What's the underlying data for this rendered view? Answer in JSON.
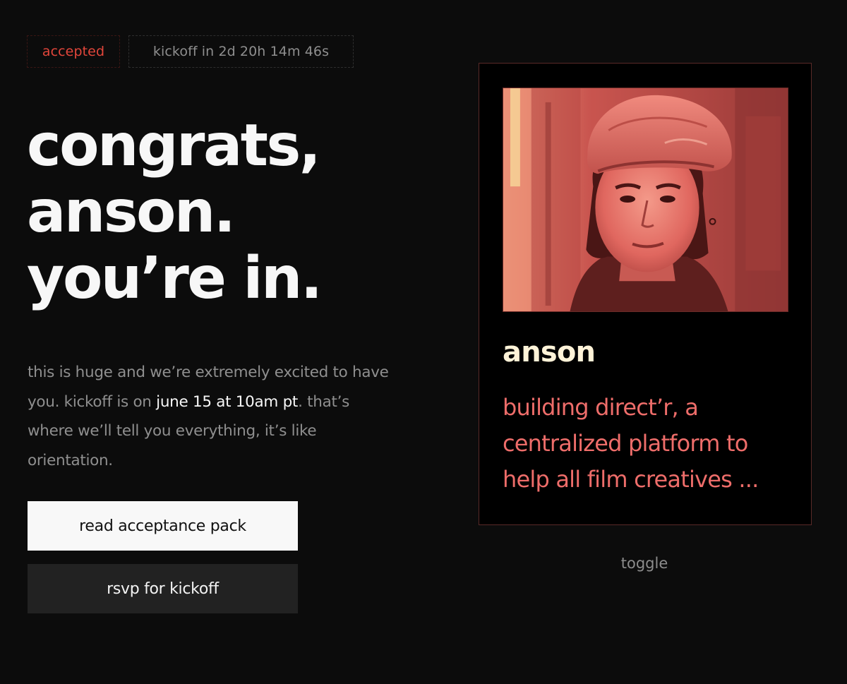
{
  "status": {
    "badge_label": "accepted",
    "countdown": "kickoff in 2d 20h 14m 46s"
  },
  "headline": {
    "line1": "congrats,",
    "line2": "anson.",
    "line3": "you’re in."
  },
  "body": {
    "part1": "this is huge and we’re extremely excited to have you. kickoff is on ",
    "highlight": "june 15 at 10am pt",
    "part2": ". that’s where we’ll tell you everything, it’s like orientation."
  },
  "actions": {
    "read_pack_label": "read acceptance pack",
    "rsvp_label": "rsvp for kickoff"
  },
  "profile_card": {
    "name": "anson",
    "description_lines": [
      "building direct’r, a",
      "centralized platform to",
      "help all film creatives ..."
    ]
  },
  "toggle_label": "toggle",
  "colors": {
    "background": "#0c0c0c",
    "accent_red": "#e2463b",
    "card_text_red": "#ee6d6a",
    "card_name": "#fff3d8",
    "photo_tint": "#e8625c"
  }
}
